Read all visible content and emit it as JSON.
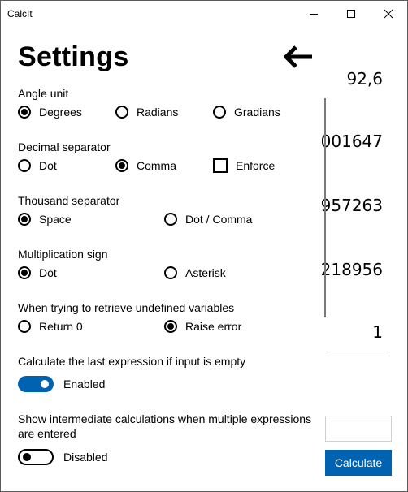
{
  "window": {
    "title": "CalcIt"
  },
  "background": {
    "results": [
      "92,6",
      "001647",
      "957263",
      "218956",
      "1"
    ],
    "calculate_label": "Calculate"
  },
  "settings": {
    "title": "Settings",
    "angle_unit": {
      "label": "Angle unit",
      "options": [
        "Degrees",
        "Radians",
        "Gradians"
      ],
      "selected": "Degrees"
    },
    "decimal_separator": {
      "label": "Decimal separator",
      "options": [
        "Dot",
        "Comma"
      ],
      "selected": "Comma",
      "enforce_label": "Enforce",
      "enforce_checked": false
    },
    "thousand_separator": {
      "label": "Thousand separator",
      "options": [
        "Space",
        "Dot / Comma"
      ],
      "selected": "Space"
    },
    "multiplication_sign": {
      "label": "Multiplication sign",
      "options": [
        "Dot",
        "Asterisk"
      ],
      "selected": "Dot"
    },
    "undefined_variables": {
      "label": "When trying to retrieve undefined variables",
      "options": [
        "Return 0",
        "Raise error"
      ],
      "selected": "Raise error"
    },
    "calc_last_expression": {
      "label": "Calculate the last expression if input is empty",
      "state_label": "Enabled",
      "on": true
    },
    "show_intermediate": {
      "label_line1": "Show intermediate calculations when multiple expressions",
      "label_line2": "are entered",
      "state_label": "Disabled",
      "on": false
    }
  },
  "colors": {
    "accent": "#0063b1",
    "border": "#5a5a5a"
  }
}
